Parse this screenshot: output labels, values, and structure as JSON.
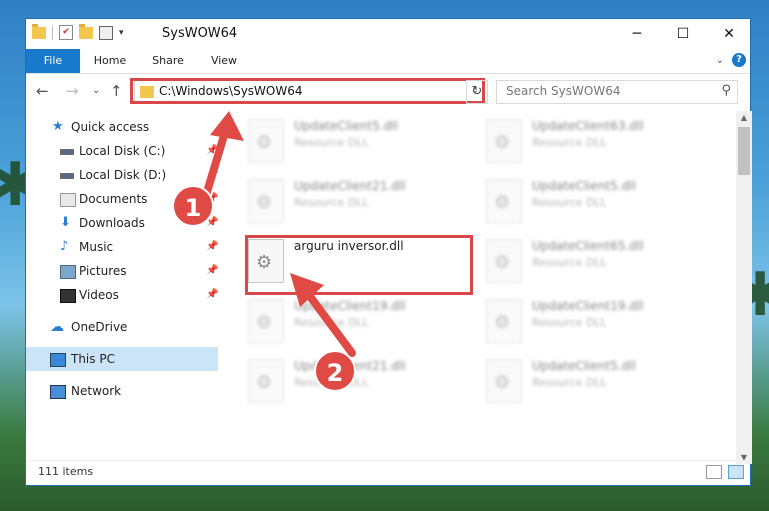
{
  "window": {
    "title": "SysWOW64"
  },
  "ribbon": {
    "tabs": [
      "File",
      "Home",
      "Share",
      "View"
    ]
  },
  "address": {
    "path": "C:\\Windows\\SysWOW64"
  },
  "search": {
    "placeholder": "Search SysWOW64"
  },
  "sidebar": {
    "items": [
      {
        "label": "Quick access"
      },
      {
        "label": "Local Disk (C:)"
      },
      {
        "label": "Local Disk (D:)"
      },
      {
        "label": "Documents"
      },
      {
        "label": "Downloads"
      },
      {
        "label": "Music"
      },
      {
        "label": "Pictures"
      },
      {
        "label": "Videos"
      },
      {
        "label": "OneDrive"
      },
      {
        "label": "This PC"
      },
      {
        "label": "Network"
      }
    ]
  },
  "files": [
    {
      "name": "UpdateClient5.dll",
      "type": "Resource DLL"
    },
    {
      "name": "UpdateClient63.dll",
      "type": "Resource DLL"
    },
    {
      "name": "UpdateClient21.dll",
      "type": "Resource DLL"
    },
    {
      "name": "UpdateClient5.dll",
      "type": "Resource DLL"
    },
    {
      "name": "arguru inversor.dll",
      "type": ""
    },
    {
      "name": "UpdateClient65.dll",
      "type": "Resource DLL"
    },
    {
      "name": "UpdateClient19.dll",
      "type": "Resource DLL"
    },
    {
      "name": "UpdateClient19.dll",
      "type": "Resource DLL"
    },
    {
      "name": "UpdateClient21.dll",
      "type": "Resource DLL"
    },
    {
      "name": "UpdateClient5.dll",
      "type": "Resource DLL"
    }
  ],
  "status": {
    "items": "111 items"
  },
  "callouts": [
    "1",
    "2"
  ],
  "colors": {
    "accent": "#1979ca",
    "highlight": "#d9474b"
  }
}
